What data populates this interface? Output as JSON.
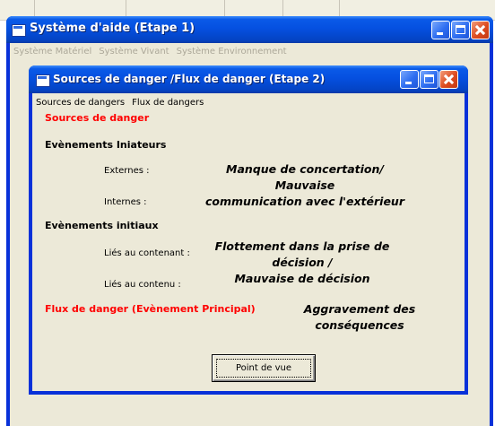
{
  "outer_window": {
    "title": "Système d'aide (Etape 1)",
    "menu": [
      "Système Matériel",
      "Système Vivant",
      "Système Environnement"
    ]
  },
  "inner_window": {
    "title": "Sources de danger /Flux de danger (Etape 2)",
    "menu": [
      "Sources de dangers",
      "Flux de dangers"
    ]
  },
  "form": {
    "sources_heading": "Sources de danger",
    "evenements_iniateurs": "Evènements Iniateurs",
    "externes_label": "Externes :",
    "externes_value_line1": "Manque de concertation/ Mauvaise",
    "externes_value_line2": "communication avec l'extérieur",
    "internes_label": "Internes :",
    "evenements_initiaux": "Evènements initiaux",
    "contenant_label": "Liés au contenant :",
    "contenant_value_line1": "Flottement dans la prise de décision /",
    "contenant_value_line2": "Mauvaise de décision",
    "contenu_label": "Liés au contenu :",
    "flux_heading": "Flux de danger (Evènement Principal)",
    "flux_value_line1": "Aggravement des",
    "flux_value_line2": "conséquences",
    "button_label": "Point de vue"
  }
}
